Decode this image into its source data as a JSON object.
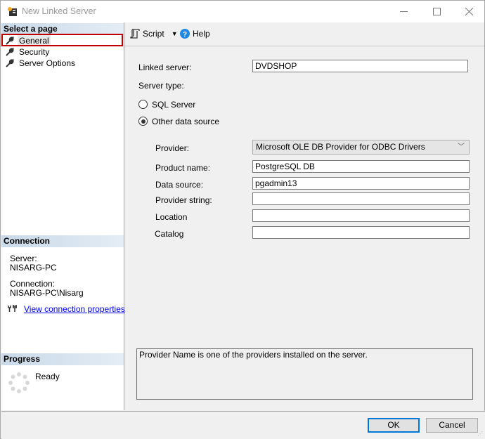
{
  "window": {
    "title": "New Linked Server",
    "icon": "ssms-dialog-icon",
    "controls": [
      "minimize",
      "maximize",
      "close"
    ]
  },
  "left_panel": {
    "select_page_header": "Select a page",
    "pages": [
      {
        "label": "General",
        "icon": "wrench-icon",
        "selected": true
      },
      {
        "label": "Security",
        "icon": "wrench-icon",
        "selected": false
      },
      {
        "label": "Server Options",
        "icon": "wrench-icon",
        "selected": false
      }
    ],
    "connection_header": "Connection",
    "server_label": "Server:",
    "server_value": "NISARG-PC",
    "connection_label": "Connection:",
    "connection_value": "NISARG-PC\\Nisarg",
    "view_connection_link": "View connection properties",
    "progress_header": "Progress",
    "progress_status": "Ready"
  },
  "toolbar": {
    "script_label": "Script",
    "help_label": "Help"
  },
  "form": {
    "linked_server_label": "Linked server:",
    "linked_server_value": "DVDSHOP",
    "server_type_label": "Server type:",
    "server_type_options": [
      {
        "label": "SQL Server",
        "checked": false
      },
      {
        "label": "Other data source",
        "checked": true
      }
    ],
    "provider_label": "Provider:",
    "provider_value": "Microsoft OLE DB Provider for ODBC Drivers",
    "product_name_label": "Product name:",
    "product_name_value": "PostgreSQL DB",
    "data_source_label": "Data source:",
    "data_source_value": "pgadmin13",
    "provider_string_label": "Provider string:",
    "provider_string_value": "",
    "location_label": "Location",
    "location_value": "",
    "catalog_label": "Catalog",
    "catalog_value": ""
  },
  "description": "Provider Name is one of the providers installed on the server.",
  "buttons": {
    "ok": "OK",
    "cancel": "Cancel"
  },
  "colors": {
    "selection_border": "#c00000",
    "ok_focus": "#0078d7",
    "link": "#0000ee"
  }
}
